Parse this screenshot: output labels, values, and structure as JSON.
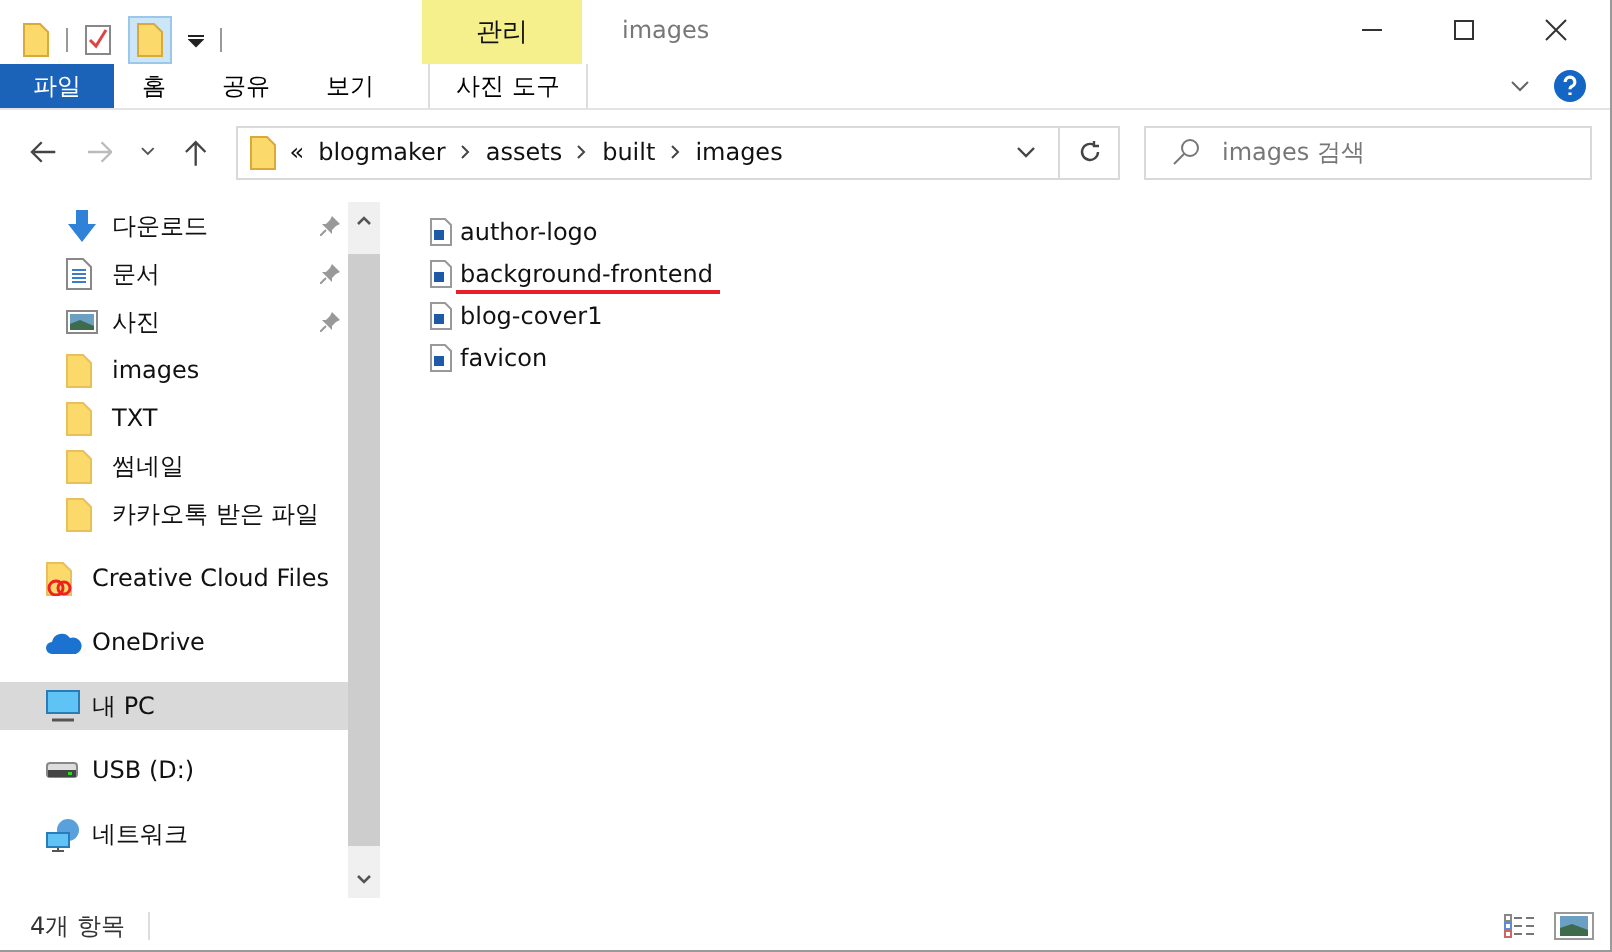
{
  "window": {
    "title": "images",
    "context_tab": "관리"
  },
  "ribbon_tabs": [
    {
      "label": "파일",
      "kind": "file",
      "selected": false
    },
    {
      "label": "홈",
      "kind": "tab",
      "selected": false
    },
    {
      "label": "공유",
      "kind": "tab",
      "selected": false
    },
    {
      "label": "보기",
      "kind": "tab",
      "selected": false
    },
    {
      "label": "사진 도구",
      "kind": "context",
      "selected": false
    }
  ],
  "address": {
    "overflow": "«",
    "segments": [
      "blogmaker",
      "assets",
      "built",
      "images"
    ]
  },
  "search": {
    "placeholder": "images 검색"
  },
  "sidebar": {
    "groups": [
      [
        {
          "label": "다운로드",
          "kind": "download",
          "pinned": true,
          "selected": false
        },
        {
          "label": "문서",
          "kind": "document",
          "pinned": true,
          "selected": false
        },
        {
          "label": "사진",
          "kind": "photo",
          "pinned": true,
          "selected": false
        },
        {
          "label": "images",
          "kind": "folder",
          "pinned": false,
          "selected": false
        },
        {
          "label": "TXT",
          "kind": "folder",
          "pinned": false,
          "selected": false
        },
        {
          "label": "썸네일",
          "kind": "folder",
          "pinned": false,
          "selected": false
        },
        {
          "label": "카카오톡 받은 파일",
          "kind": "folder",
          "pinned": false,
          "selected": false
        }
      ],
      [
        {
          "label": "Creative Cloud Files",
          "kind": "cloudfolder",
          "pinned": false,
          "selected": false
        }
      ],
      [
        {
          "label": "OneDrive",
          "kind": "onedrive",
          "pinned": false,
          "selected": false
        }
      ],
      [
        {
          "label": "내 PC",
          "kind": "pc",
          "pinned": false,
          "selected": true
        }
      ],
      [
        {
          "label": "USB (D:)",
          "kind": "usb",
          "pinned": false,
          "selected": false
        }
      ],
      [
        {
          "label": "네트워크",
          "kind": "network",
          "pinned": false,
          "selected": false
        }
      ]
    ]
  },
  "files": [
    {
      "name": "author-logo",
      "underlined": false
    },
    {
      "name": "background-frontend",
      "underlined": true
    },
    {
      "name": "blog-cover1",
      "underlined": false
    },
    {
      "name": "favicon",
      "underlined": false
    }
  ],
  "status_bar": {
    "count": "4개 항목",
    "views": [
      {
        "kind": "details",
        "selected": false
      },
      {
        "kind": "large",
        "selected": true
      }
    ]
  }
}
